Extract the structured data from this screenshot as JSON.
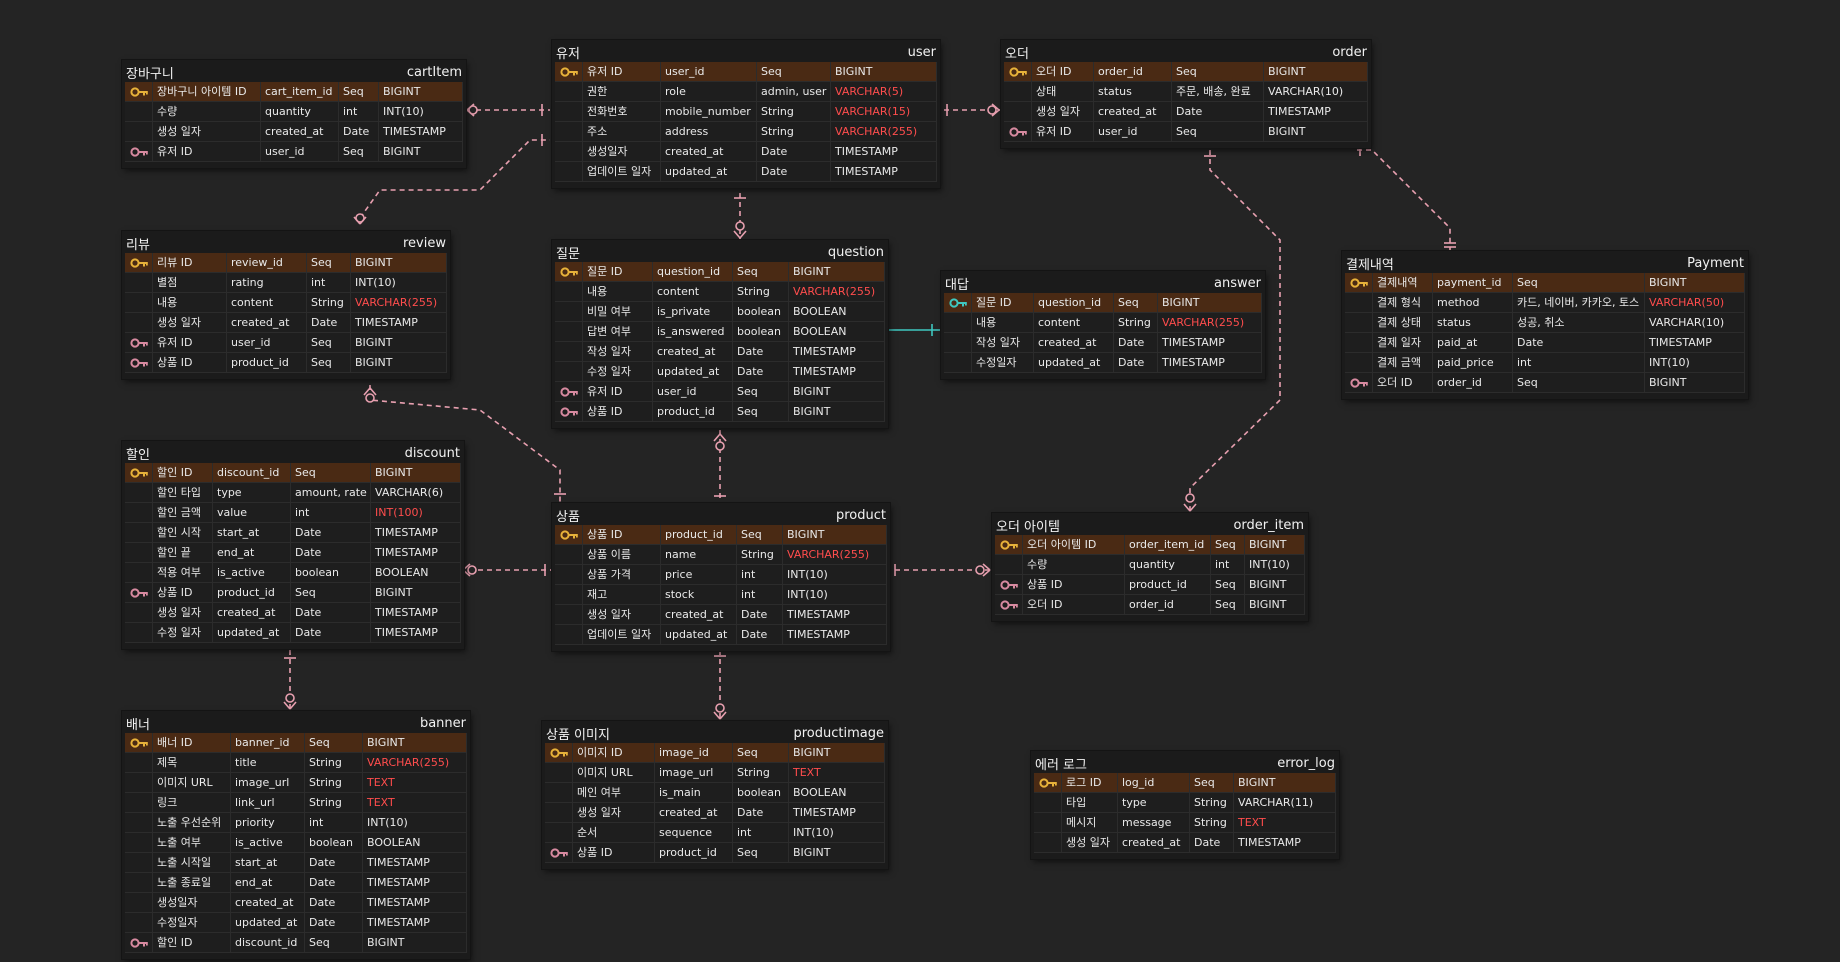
{
  "colors": {
    "background": "#242424",
    "pk_row": "#4a2a14",
    "pk_key": "#e8b23a",
    "fk_key": "#d78aa0",
    "relation_line": "#e8a0b0",
    "one_to_one_line": "#3fc8c0",
    "red_type": "#ff4d4d"
  },
  "tables": [
    {
      "id": "cartItem",
      "title_ko": "장바구니",
      "title_en": "cartItem",
      "rows": [
        {
          "key": "pk",
          "ko": "장바구니 아이템 ID",
          "en": "cart_item_id",
          "kind": "Seq",
          "type": "BIGINT"
        },
        {
          "key": "",
          "ko": "수량",
          "en": "quantity",
          "kind": "int",
          "type": "INT(10)"
        },
        {
          "key": "",
          "ko": "생성 일자",
          "en": "created_at",
          "kind": "Date",
          "type": "TIMESTAMP"
        },
        {
          "key": "fk",
          "ko": "유저 ID",
          "en": "user_id",
          "kind": "Seq",
          "type": "BIGINT"
        }
      ]
    },
    {
      "id": "user",
      "title_ko": "유저",
      "title_en": "user",
      "rows": [
        {
          "key": "pk",
          "ko": "유저 ID",
          "en": "user_id",
          "kind": "Seq",
          "type": "BIGINT"
        },
        {
          "key": "",
          "ko": "권한",
          "en": "role",
          "kind": "admin, user",
          "type": "VARCHAR(5)",
          "red": true
        },
        {
          "key": "",
          "ko": "전화번호",
          "en": "mobile_number",
          "kind": "String",
          "type": "VARCHAR(15)",
          "red": true
        },
        {
          "key": "",
          "ko": "주소",
          "en": "address",
          "kind": "String",
          "type": "VARCHAR(255)",
          "red": true
        },
        {
          "key": "",
          "ko": "생성일자",
          "en": "created_at",
          "kind": "Date",
          "type": "TIMESTAMP"
        },
        {
          "key": "",
          "ko": "업데이트 일자",
          "en": "updated_at",
          "kind": "Date",
          "type": "TIMESTAMP"
        }
      ]
    },
    {
      "id": "order",
      "title_ko": "오더",
      "title_en": "order",
      "rows": [
        {
          "key": "pk",
          "ko": "오더 ID",
          "en": "order_id",
          "kind": "Seq",
          "type": "BIGINT"
        },
        {
          "key": "",
          "ko": "상태",
          "en": "status",
          "kind": "주문, 배송, 완료",
          "type": "VARCHAR(10)"
        },
        {
          "key": "",
          "ko": "생성 일자",
          "en": "created_at",
          "kind": "Date",
          "type": "TIMESTAMP"
        },
        {
          "key": "fk",
          "ko": "유저 ID",
          "en": "user_id",
          "kind": "Seq",
          "type": "BIGINT"
        }
      ]
    },
    {
      "id": "review",
      "title_ko": "리뷰",
      "title_en": "review",
      "rows": [
        {
          "key": "pk",
          "ko": "리뷰 ID",
          "en": "review_id",
          "kind": "Seq",
          "type": "BIGINT"
        },
        {
          "key": "",
          "ko": "별점",
          "en": "rating",
          "kind": "int",
          "type": "INT(10)"
        },
        {
          "key": "",
          "ko": "내용",
          "en": "content",
          "kind": "String",
          "type": "VARCHAR(255)",
          "red": true
        },
        {
          "key": "",
          "ko": "생성 일자",
          "en": "created_at",
          "kind": "Date",
          "type": "TIMESTAMP"
        },
        {
          "key": "fk",
          "ko": "유저 ID",
          "en": "user_id",
          "kind": "Seq",
          "type": "BIGINT"
        },
        {
          "key": "fk",
          "ko": "상품 ID",
          "en": "product_id",
          "kind": "Seq",
          "type": "BIGINT"
        }
      ]
    },
    {
      "id": "question",
      "title_ko": "질문",
      "title_en": "question",
      "rows": [
        {
          "key": "pk",
          "ko": "질문 ID",
          "en": "question_id",
          "kind": "Seq",
          "type": "BIGINT"
        },
        {
          "key": "",
          "ko": "내용",
          "en": "content",
          "kind": "String",
          "type": "VARCHAR(255)",
          "red": true
        },
        {
          "key": "",
          "ko": "비밀 여부",
          "en": "is_private",
          "kind": "boolean",
          "type": "BOOLEAN"
        },
        {
          "key": "",
          "ko": "답변 여부",
          "en": "is_answered",
          "kind": "boolean",
          "type": "BOOLEAN"
        },
        {
          "key": "",
          "ko": "작성 일자",
          "en": "created_at",
          "kind": "Date",
          "type": "TIMESTAMP"
        },
        {
          "key": "",
          "ko": "수정 일자",
          "en": "updated_at",
          "kind": "Date",
          "type": "TIMESTAMP"
        },
        {
          "key": "fk",
          "ko": "유저 ID",
          "en": "user_id",
          "kind": "Seq",
          "type": "BIGINT"
        },
        {
          "key": "fk",
          "ko": "상품 ID",
          "en": "product_id",
          "kind": "Seq",
          "type": "BIGINT"
        }
      ]
    },
    {
      "id": "answer",
      "title_ko": "대답",
      "title_en": "answer",
      "rows": [
        {
          "key": "pk2",
          "ko": "질문 ID",
          "en": "question_id",
          "kind": "Seq",
          "type": "BIGINT"
        },
        {
          "key": "",
          "ko": "내용",
          "en": "content",
          "kind": "String",
          "type": "VARCHAR(255)",
          "red": true
        },
        {
          "key": "",
          "ko": "작성 일자",
          "en": "created_at",
          "kind": "Date",
          "type": "TIMESTAMP"
        },
        {
          "key": "",
          "ko": "수정일자",
          "en": "updated_at",
          "kind": "Date",
          "type": "TIMESTAMP"
        }
      ]
    },
    {
      "id": "Payment",
      "title_ko": "결제내역",
      "title_en": "Payment",
      "rows": [
        {
          "key": "pk",
          "ko": "결제내역",
          "en": "payment_id",
          "kind": "Seq",
          "type": "BIGINT"
        },
        {
          "key": "",
          "ko": "결제 형식",
          "en": "method",
          "kind": "카드, 네이버, 카카오, 토스",
          "type": "VARCHAR(50)",
          "red": true
        },
        {
          "key": "",
          "ko": "결제 상태",
          "en": "status",
          "kind": "성공, 취소",
          "type": "VARCHAR(10)"
        },
        {
          "key": "",
          "ko": "결제 일자",
          "en": "paid_at",
          "kind": "Date",
          "type": "TIMESTAMP"
        },
        {
          "key": "",
          "ko": "결제 금액",
          "en": "paid_price",
          "kind": "int",
          "type": "INT(10)"
        },
        {
          "key": "fk",
          "ko": "오더 ID",
          "en": "order_id",
          "kind": "Seq",
          "type": "BIGINT"
        }
      ]
    },
    {
      "id": "discount",
      "title_ko": "할인",
      "title_en": "discount",
      "rows": [
        {
          "key": "pk",
          "ko": "할인 ID",
          "en": "discount_id",
          "kind": "Seq",
          "type": "BIGINT"
        },
        {
          "key": "",
          "ko": "할인 타입",
          "en": "type",
          "kind": "amount, rate",
          "type": "VARCHAR(6)"
        },
        {
          "key": "",
          "ko": "할인 금액",
          "en": "value",
          "kind": "int",
          "type": "INT(100)",
          "red": true
        },
        {
          "key": "",
          "ko": "할인 시작",
          "en": "start_at",
          "kind": "Date",
          "type": "TIMESTAMP"
        },
        {
          "key": "",
          "ko": "할인 끝",
          "en": "end_at",
          "kind": "Date",
          "type": "TIMESTAMP"
        },
        {
          "key": "",
          "ko": "적용 여부",
          "en": "is_active",
          "kind": "boolean",
          "type": "BOOLEAN"
        },
        {
          "key": "fk",
          "ko": "상품 ID",
          "en": "product_id",
          "kind": "Seq",
          "type": "BIGINT"
        },
        {
          "key": "",
          "ko": "생성 일자",
          "en": "created_at",
          "kind": "Date",
          "type": "TIMESTAMP"
        },
        {
          "key": "",
          "ko": "수정 일자",
          "en": "updated_at",
          "kind": "Date",
          "type": "TIMESTAMP"
        }
      ]
    },
    {
      "id": "product",
      "title_ko": "상품",
      "title_en": "product",
      "rows": [
        {
          "key": "pk",
          "ko": "상품 ID",
          "en": "product_id",
          "kind": "Seq",
          "type": "BIGINT"
        },
        {
          "key": "",
          "ko": "상품 이름",
          "en": "name",
          "kind": "String",
          "type": "VARCHAR(255)",
          "red": true
        },
        {
          "key": "",
          "ko": "상품 가격",
          "en": "price",
          "kind": "int",
          "type": "INT(10)"
        },
        {
          "key": "",
          "ko": "재고",
          "en": "stock",
          "kind": "int",
          "type": "INT(10)"
        },
        {
          "key": "",
          "ko": "생성 일자",
          "en": "created_at",
          "kind": "Date",
          "type": "TIMESTAMP"
        },
        {
          "key": "",
          "ko": "업데이트 일자",
          "en": "updated_at",
          "kind": "Date",
          "type": "TIMESTAMP"
        }
      ]
    },
    {
      "id": "order_item",
      "title_ko": "오더 아이템",
      "title_en": "order_item",
      "rows": [
        {
          "key": "pk",
          "ko": "오더 아이템 ID",
          "en": "order_item_id",
          "kind": "Seq",
          "type": "BIGINT"
        },
        {
          "key": "",
          "ko": "수량",
          "en": "quantity",
          "kind": "int",
          "type": "INT(10)"
        },
        {
          "key": "fk",
          "ko": "상품 ID",
          "en": "product_id",
          "kind": "Seq",
          "type": "BIGINT"
        },
        {
          "key": "fk",
          "ko": "오더 ID",
          "en": "order_id",
          "kind": "Seq",
          "type": "BIGINT"
        }
      ]
    },
    {
      "id": "banner",
      "title_ko": "배너",
      "title_en": "banner",
      "rows": [
        {
          "key": "pk",
          "ko": "배너 ID",
          "en": "banner_id",
          "kind": "Seq",
          "type": "BIGINT"
        },
        {
          "key": "",
          "ko": "제목",
          "en": "title",
          "kind": "String",
          "type": "VARCHAR(255)",
          "red": true
        },
        {
          "key": "",
          "ko": "이미지 URL",
          "en": "image_url",
          "kind": "String",
          "type": "TEXT",
          "red": true
        },
        {
          "key": "",
          "ko": "링크",
          "en": "link_url",
          "kind": "String",
          "type": "TEXT",
          "red": true
        },
        {
          "key": "",
          "ko": "노출 우선순위",
          "en": "priority",
          "kind": "int",
          "type": "INT(10)"
        },
        {
          "key": "",
          "ko": "노출 여부",
          "en": "is_active",
          "kind": "boolean",
          "type": "BOOLEAN"
        },
        {
          "key": "",
          "ko": "노출 시작일",
          "en": "start_at",
          "kind": "Date",
          "type": "TIMESTAMP"
        },
        {
          "key": "",
          "ko": "노출 종료일",
          "en": "end_at",
          "kind": "Date",
          "type": "TIMESTAMP"
        },
        {
          "key": "",
          "ko": "생성일자",
          "en": "created_at",
          "kind": "Date",
          "type": "TIMESTAMP"
        },
        {
          "key": "",
          "ko": "수정일자",
          "en": "updated_at",
          "kind": "Date",
          "type": "TIMESTAMP"
        },
        {
          "key": "fk",
          "ko": "할인 ID",
          "en": "discount_id",
          "kind": "Seq",
          "type": "BIGINT"
        }
      ]
    },
    {
      "id": "productimage",
      "title_ko": "상품 이미지",
      "title_en": "productimage",
      "rows": [
        {
          "key": "pk",
          "ko": "이미지 ID",
          "en": "image_id",
          "kind": "Seq",
          "type": "BIGINT"
        },
        {
          "key": "",
          "ko": "이미지 URL",
          "en": "image_url",
          "kind": "String",
          "type": "TEXT",
          "red": true
        },
        {
          "key": "",
          "ko": "메인 여부",
          "en": "is_main",
          "kind": "boolean",
          "type": "BOOLEAN"
        },
        {
          "key": "",
          "ko": "생성 일자",
          "en": "created_at",
          "kind": "Date",
          "type": "TIMESTAMP"
        },
        {
          "key": "",
          "ko": "순서",
          "en": "sequence",
          "kind": "int",
          "type": "INT(10)"
        },
        {
          "key": "fk",
          "ko": "상품 ID",
          "en": "product_id",
          "kind": "Seq",
          "type": "BIGINT"
        }
      ]
    },
    {
      "id": "error_log",
      "title_ko": "에러 로그",
      "title_en": "error_log",
      "rows": [
        {
          "key": "pk",
          "ko": "로그 ID",
          "en": "log_id",
          "kind": "Seq",
          "type": "BIGINT"
        },
        {
          "key": "",
          "ko": "타입",
          "en": "type",
          "kind": "String",
          "type": "VARCHAR(11)"
        },
        {
          "key": "",
          "ko": "메시지",
          "en": "message",
          "kind": "String",
          "type": "TEXT",
          "red": true
        },
        {
          "key": "",
          "ko": "생성 일자",
          "en": "created_at",
          "kind": "Date",
          "type": "TIMESTAMP"
        }
      ]
    }
  ],
  "relations": [
    {
      "from": "cartItem",
      "to": "user",
      "cardinality": "many-to-one"
    },
    {
      "from": "review",
      "to": "user",
      "cardinality": "many-to-one"
    },
    {
      "from": "order",
      "to": "user",
      "cardinality": "many-to-one"
    },
    {
      "from": "question",
      "to": "user",
      "cardinality": "many-to-one"
    },
    {
      "from": "Payment",
      "to": "order",
      "cardinality": "one-to-one"
    },
    {
      "from": "order_item",
      "to": "order",
      "cardinality": "many-to-one"
    },
    {
      "from": "answer",
      "to": "question",
      "cardinality": "one-to-one"
    },
    {
      "from": "question",
      "to": "product",
      "cardinality": "many-to-one"
    },
    {
      "from": "review",
      "to": "product",
      "cardinality": "many-to-one"
    },
    {
      "from": "discount",
      "to": "product",
      "cardinality": "many-to-one"
    },
    {
      "from": "order_item",
      "to": "product",
      "cardinality": "many-to-one"
    },
    {
      "from": "productimage",
      "to": "product",
      "cardinality": "many-to-one"
    },
    {
      "from": "banner",
      "to": "discount",
      "cardinality": "many-to-one"
    }
  ]
}
